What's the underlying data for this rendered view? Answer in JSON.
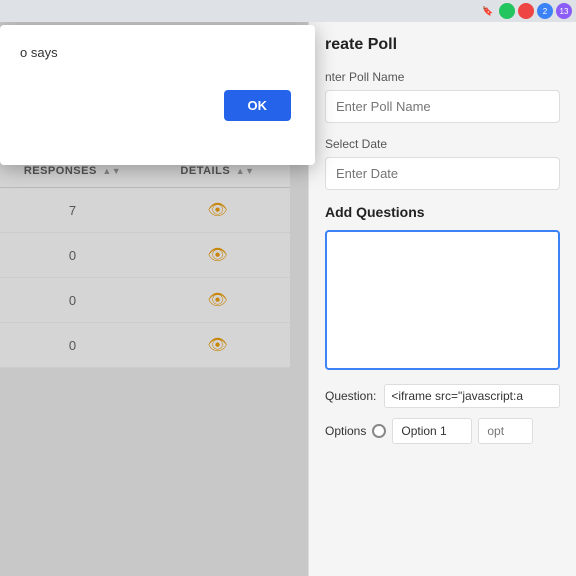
{
  "chrome_bar": {
    "icons": [
      "bookmark",
      "green-circle",
      "red-circle",
      "notification-blue",
      "notification-purple"
    ]
  },
  "alert_dialog": {
    "message": "o says",
    "ok_button_label": "OK"
  },
  "create_poll_panel": {
    "title": "reate Poll",
    "poll_name_label": "nter Poll Name",
    "poll_name_placeholder": "Enter Poll Name",
    "date_label": "Select Date",
    "date_placeholder": "Enter Date",
    "questions_section_label": "Add Questions",
    "question_field_label": "Question:",
    "question_value": "<iframe src=\"javascript:a",
    "options_label": "Options",
    "option1_value": "Option 1",
    "option2_placeholder": "opt"
  },
  "background_table": {
    "columns": [
      {
        "label": "RESPONSES"
      },
      {
        "label": "DETAILS"
      }
    ],
    "rows": [
      {
        "responses": "7",
        "has_eye": true
      },
      {
        "responses": "0",
        "has_eye": true
      },
      {
        "responses": "0",
        "has_eye": true
      },
      {
        "responses": "0",
        "has_eye": true
      }
    ]
  }
}
